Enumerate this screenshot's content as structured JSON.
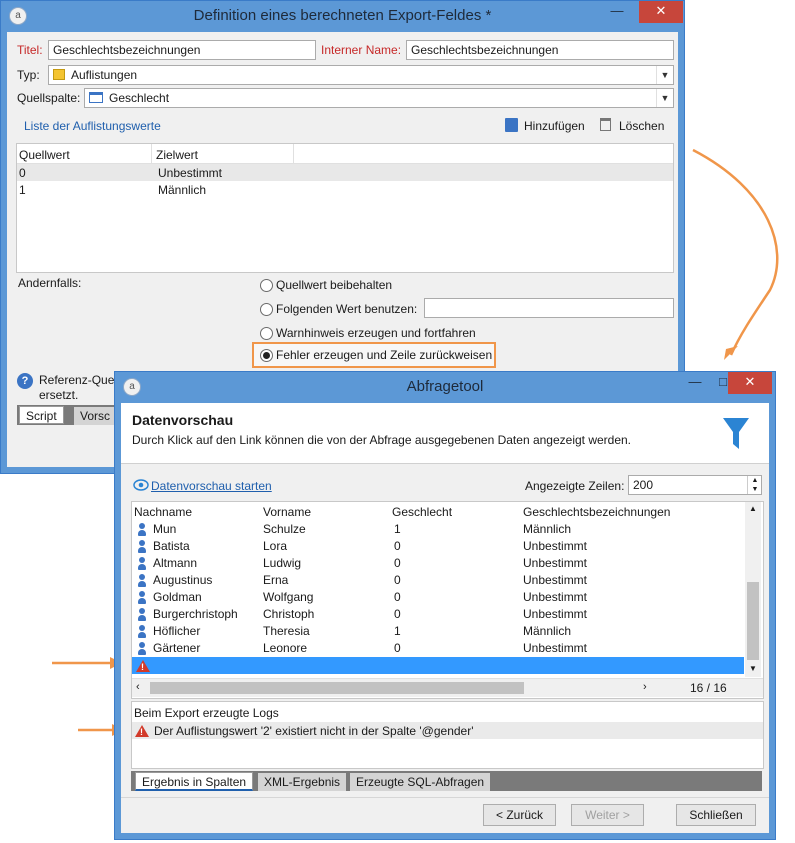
{
  "def_window": {
    "title": "Definition eines berechneten Export-Feldes *",
    "titel_label": "Titel:",
    "titel_value": "Geschlechtsbezeichnungen",
    "interner_name_label": "Interner Name:",
    "interner_name_value": "Geschlechtsbezeichnungen",
    "typ_label": "Typ:",
    "typ_value": "Auflistungen",
    "quellspalte_label": "Quellspalte:",
    "quellspalte_value": "Geschlecht",
    "liste_link": "Liste der Auflistungswerte",
    "add_label": "Hinzufügen",
    "delete_label": "Löschen",
    "columns": [
      "Quellwert",
      "Zielwert"
    ],
    "rows": [
      {
        "quellwert": "0",
        "zielwert": "Unbestimmt"
      },
      {
        "quellwert": "1",
        "zielwert": "Männlich"
      }
    ],
    "andernfalls_label": "Andernfalls:",
    "options": [
      "Quellwert beibehalten",
      "Folgenden Wert benutzen:",
      "Warnhinweis erzeugen und fortfahren",
      "Fehler erzeugen und Zeile zurückweisen"
    ],
    "selected_option": 3,
    "info_text_1": "Referenz-Quel",
    "info_text_2": "ersetzt.",
    "tabs": [
      "Script",
      "Vorsc"
    ]
  },
  "query_window": {
    "title": "Abfragetool",
    "heading": "Datenvorschau",
    "subheading": "Durch Klick auf den Link können die von der Abfrage ausgegebenen Daten angezeigt werden.",
    "preview_link": "Datenvorschau starten",
    "rows_label": "Angezeigte Zeilen:",
    "rows_value": "200",
    "columns": [
      "Nachname",
      "Vorname",
      "Geschlecht",
      "Geschlechtsbezeichnungen"
    ],
    "rows": [
      {
        "nachname": "Mun",
        "vorname": "Schulze",
        "geschlecht": "1",
        "bezeichnung": "Männlich"
      },
      {
        "nachname": "Batista",
        "vorname": "Lora",
        "geschlecht": "0",
        "bezeichnung": "Unbestimmt"
      },
      {
        "nachname": "Altmann",
        "vorname": "Ludwig",
        "geschlecht": "0",
        "bezeichnung": "Unbestimmt"
      },
      {
        "nachname": "Augustinus",
        "vorname": "Erna",
        "geschlecht": "0",
        "bezeichnung": "Unbestimmt"
      },
      {
        "nachname": "Goldman",
        "vorname": "Wolfgang",
        "geschlecht": "0",
        "bezeichnung": "Unbestimmt"
      },
      {
        "nachname": "Burgerchristoph",
        "vorname": "Christoph",
        "geschlecht": "0",
        "bezeichnung": "Unbestimmt"
      },
      {
        "nachname": "Höflicher",
        "vorname": "Theresia",
        "geschlecht": "1",
        "bezeichnung": "Männlich"
      },
      {
        "nachname": "Gärtener",
        "vorname": "Leonore",
        "geschlecht": "0",
        "bezeichnung": "Unbestimmt"
      }
    ],
    "row_count": "16 / 16",
    "logs_title": "Beim Export erzeugte Logs",
    "log_message": "Der Auflistungswert '2' existiert nicht in der Spalte '@gender'",
    "tabs": [
      "Ergebnis in Spalten",
      "XML-Ergebnis",
      "Erzeugte SQL-Abfragen"
    ],
    "back_button": "< Zurück",
    "next_button": "Weiter >",
    "close_button": "Schließen"
  },
  "colors": {
    "accent": "#f0964a",
    "selection": "#3399ff",
    "window_border": "#5c98d6"
  }
}
